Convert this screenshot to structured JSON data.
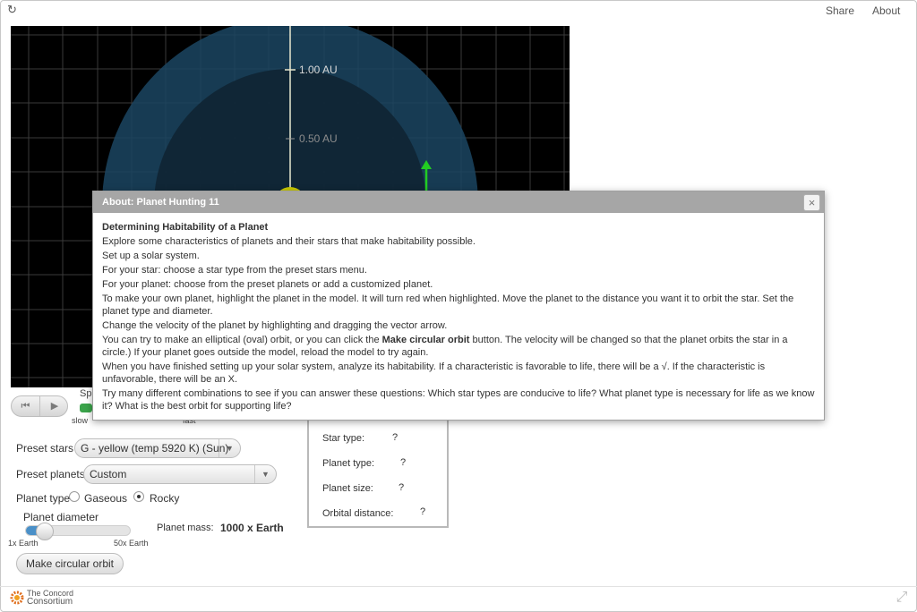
{
  "topbar": {
    "reload_icon": "reload-icon",
    "share_label": "Share",
    "about_label": "About"
  },
  "simulation": {
    "labels": {
      "ring_outer": "1.00 AU",
      "ring_inner": "0.50 AU"
    },
    "colors": {
      "zone_outer": "#183a55",
      "zone_inner": "#0d1f2c",
      "grid": "#3a3a3a",
      "axis": "#e8e8d0",
      "star": "#d4d400",
      "velocity_arrow": "#22cc22"
    }
  },
  "playback": {
    "back_icon": "skip-back-icon",
    "play_icon": "play-icon"
  },
  "speed": {
    "label": "Sp",
    "slow": "slow",
    "fast": "fast"
  },
  "controls": {
    "preset_stars_label": "Preset stars",
    "preset_stars_value": "G - yellow (temp 5920 K) (Sun)",
    "preset_planets_label": "Preset planets",
    "preset_planets_value": "Custom",
    "planet_type_label": "Planet type",
    "planet_type_options": [
      "Gaseous",
      "Rocky"
    ],
    "planet_type_selected": "Rocky",
    "planet_diameter_label": "Planet diameter",
    "diameter_min": "1x Earth",
    "diameter_max": "50x Earth",
    "planet_mass_label": "Planet mass:",
    "planet_mass_value": "1000 x Earth",
    "circular_orbit_button": "Make circular orbit"
  },
  "habitability": {
    "rows": [
      {
        "label": "Star type:",
        "value": "?"
      },
      {
        "label": "Planet type:",
        "value": "?"
      },
      {
        "label": "Planet size:",
        "value": "?"
      },
      {
        "label": "Orbital distance:",
        "value": "?"
      }
    ]
  },
  "footer": {
    "logo_line1": "The Concord",
    "logo_line2": "Consortium",
    "fullscreen_icon": "fullscreen-icon"
  },
  "dialog": {
    "title": "About: Planet Hunting 11",
    "close": "×",
    "heading": "Determining Habitability of a Planet",
    "paragraphs": [
      "Explore some characteristics of planets and their stars that make habitability possible.",
      "Set up a solar system.",
      "For your star: choose a star type from the preset stars menu.",
      "For your planet: choose from the preset planets or add a customized planet.",
      "To make your own planet, highlight the planet in the model. It will turn red when highlighted. Move the planet to the distance you want it to orbit the star. Set the planet type and diameter.",
      "Change the velocity of the planet by highlighting and dragging the vector arrow."
    ],
    "p7_before": "You can try to make an elliptical (oval) orbit, or you can click the ",
    "p7_bold": "Make circular orbit",
    "p7_after": " button. The velocity will be changed so that the planet orbits the star in a circle.) If your planet goes outside the model, reload the model to try again.",
    "p8": "When you have finished setting up your solar system, analyze its habitability. If a characteristic is favorable to life, there will be a √. If the characteristic is unfavorable, there will be an X.",
    "p9": "Try many different combinations to see if you can answer these questions: Which star types are conducive to life? What planet type is necessary for life as we know it? What is the best orbit for supporting life?"
  }
}
